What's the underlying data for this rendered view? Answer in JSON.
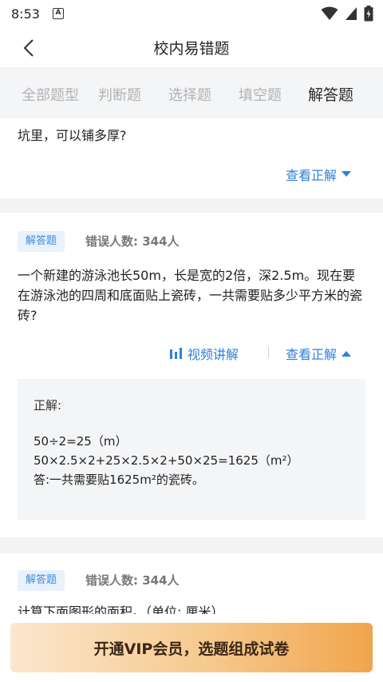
{
  "status_bar": {
    "time": "8:53",
    "notif_icon": "A"
  },
  "nav": {
    "title": "校内易错题"
  },
  "tabs": [
    {
      "label": "全部题型"
    },
    {
      "label": "判断题"
    },
    {
      "label": "选择题"
    },
    {
      "label": "填空题"
    },
    {
      "label": "解答题"
    }
  ],
  "cards": {
    "first": {
      "text": "坑里，可以铺多厚?",
      "view_answer": "查看正解"
    },
    "second": {
      "tag": "解答题",
      "wrong_count": "错误人数: 344人",
      "text": "一个新建的游泳池长50m，长是宽的2倍，深2.5m。现在要在游泳池的四周和底面贴上瓷砖，一共需要贴多少平方米的瓷砖?",
      "video_label": "视频讲解",
      "view_answer": "查看正解",
      "answer": {
        "title": "正解:",
        "lines": [
          "50÷2=25（m）",
          "50×2.5×2+25×2.5×2+50×25=1625（m²）",
          "答:一共需要贴1625m²的瓷砖。"
        ]
      }
    },
    "third": {
      "tag": "解答题",
      "wrong_count": "错误人数: 344人",
      "text": "计算下面图形的面积。（单位: 厘米）"
    }
  },
  "footer": {
    "vip_button": "开通VIP会员，选题组成试卷"
  },
  "colors": {
    "accent_blue": "#2f7fd6",
    "tag_bg": "#e8f1fc",
    "vip_start": "#fbe7cd",
    "vip_end": "#f0a54c"
  }
}
